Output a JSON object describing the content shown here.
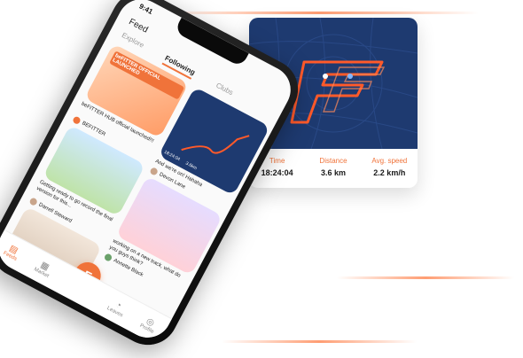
{
  "colors": {
    "accent": "#f0733a",
    "map_bg": "#1e3a70",
    "route": "#ff5a2a"
  },
  "card": {
    "stats": [
      {
        "label": "Time",
        "value": "18:24:04"
      },
      {
        "label": "Distance",
        "value": "3.6 km"
      },
      {
        "label": "Avg. speed",
        "value": "2.2 km/h"
      }
    ]
  },
  "phone": {
    "status_time": "9:41",
    "header": {
      "title": "Feed"
    },
    "tabs": [
      {
        "label": "Explore"
      },
      {
        "label": "Following"
      },
      {
        "label": "Clubs"
      }
    ],
    "posts": [
      {
        "caption": "beFITTER HUB official launched!!!",
        "author": "BEFITTER",
        "banner": "beFITTER OFFICIAL LAUNCHED"
      },
      {
        "caption": "And we're on! Hahaha",
        "author": "Devon Lane",
        "time": "18:24:04",
        "distance": "3.6km"
      },
      {
        "caption": "Getting ready to go record the final version for this...",
        "author": "Darrell Steward"
      },
      {
        "caption": "working on a new track, what do you guys think?",
        "author": "Annette Black"
      }
    ],
    "nav": [
      {
        "label": "Feeds",
        "icon": "feeds-icon"
      },
      {
        "label": "Market",
        "icon": "market-icon"
      },
      {
        "label": "Leaves",
        "icon": "leaves-icon"
      },
      {
        "label": "Profile",
        "icon": "profile-icon"
      }
    ]
  }
}
